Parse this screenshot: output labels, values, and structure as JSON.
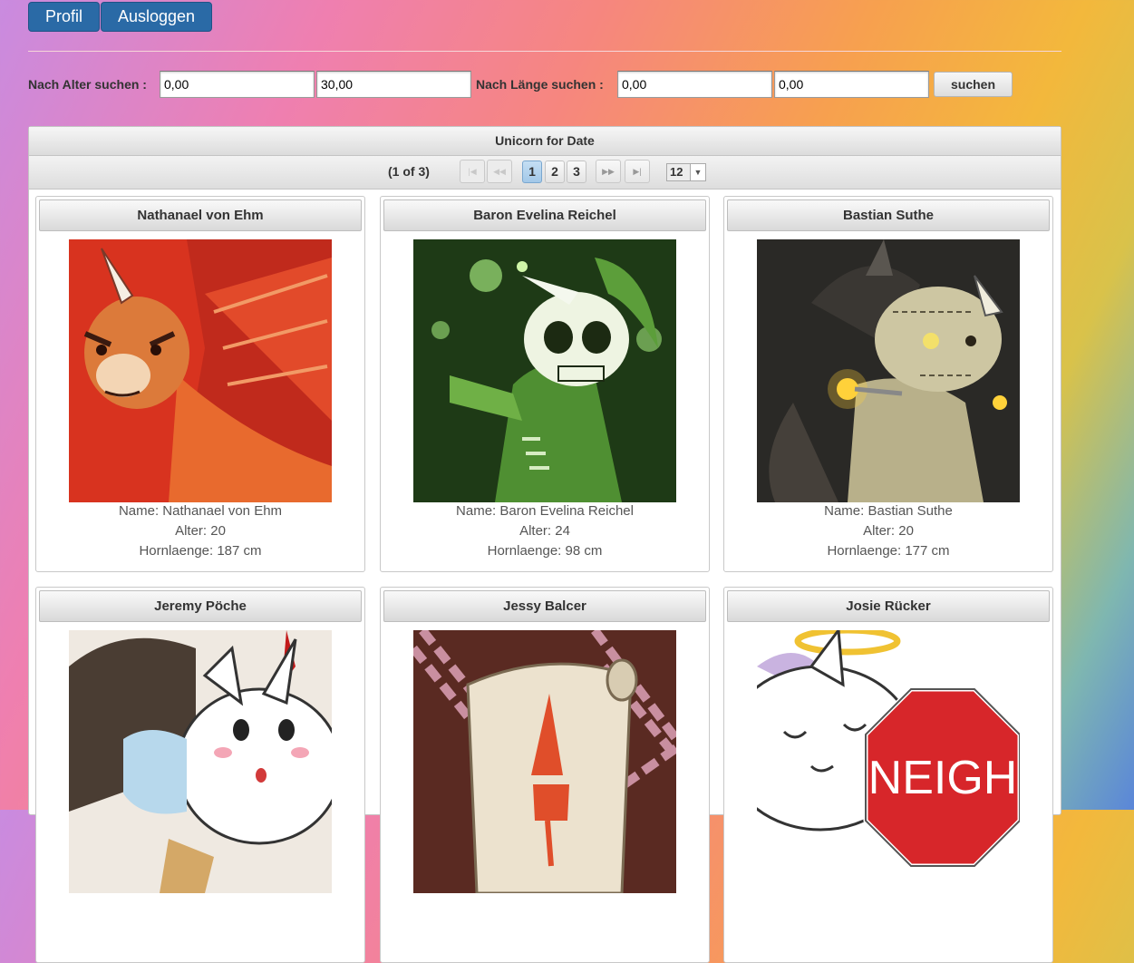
{
  "header": {
    "profile_label": "Profil",
    "logout_label": "Ausloggen"
  },
  "filters": {
    "age_label": "Nach Alter suchen :",
    "age_min": "0,00",
    "age_max": "30,00",
    "length_label": "Nach Länge suchen :",
    "length_min": "0,00",
    "length_max": "0,00",
    "search_label": "suchen"
  },
  "panel": {
    "title": "Unicorn for Date"
  },
  "pager": {
    "count": "(1 of 3)",
    "first_icon": "first-page-icon",
    "prev_icon": "prev-page-icon",
    "next_icon": "next-page-icon",
    "last_icon": "last-page-icon",
    "pages": [
      "1",
      "2",
      "3"
    ],
    "active_page": "1",
    "rows_per_page": "12"
  },
  "cards": [
    {
      "title": "Nathanael von Ehm",
      "name": "Name: Nathanael von Ehm",
      "age": "Alter: 20",
      "horn": "Hornlaenge: 187 cm",
      "image": "red-dragon-unicorn",
      "color": "#d8331f"
    },
    {
      "title": "Baron Evelina Reichel",
      "name": "Name: Baron Evelina Reichel",
      "age": "Alter: 24",
      "horn": "Hornlaenge: 98 cm",
      "image": "green-skeleton-unicorn",
      "color": "#5fa83a"
    },
    {
      "title": "Bastian Suthe",
      "name": "Name: Bastian Suthe",
      "age": "Alter: 20",
      "horn": "Hornlaenge: 177 cm",
      "image": "zombie-unicorn",
      "color": "#6b6650"
    },
    {
      "title": "Jeremy Pöche",
      "name": "",
      "age": "",
      "horn": "",
      "image": "white-unicorn",
      "color": "#f2f2f2"
    },
    {
      "title": "Jessy Balcer",
      "name": "",
      "age": "",
      "horn": "",
      "image": "scroll-chains",
      "color": "#5a2a22"
    },
    {
      "title": "Josie Rücker",
      "name": "",
      "image_text": "NEIGH",
      "age": "",
      "horn": "",
      "image": "halo-unicorn-stop-sign",
      "color": "#d7262a"
    }
  ]
}
